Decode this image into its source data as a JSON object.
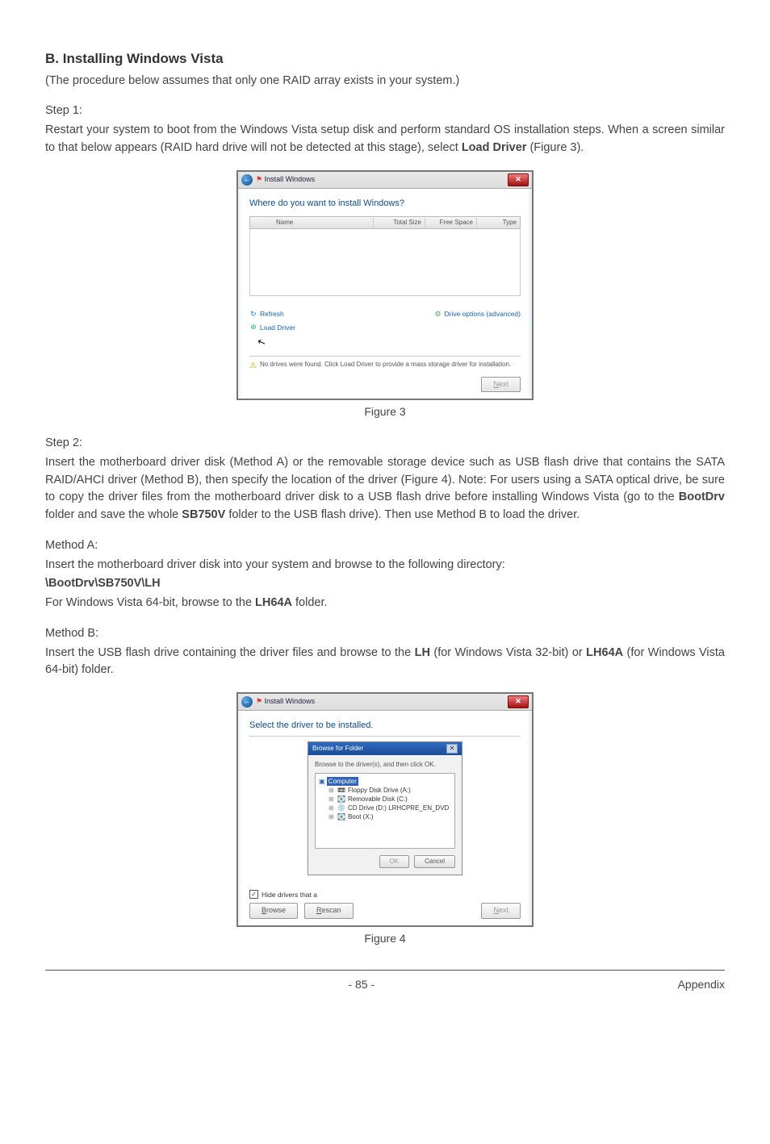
{
  "heading": "B. Installing Windows Vista",
  "subtitle": "(The procedure below assumes that only one RAID array exists in your system.)",
  "step1": {
    "label": "Step 1:",
    "text_parts": [
      "Restart your system to boot from the Windows Vista setup disk and perform standard OS installation steps. When a screen similar to that below appears (RAID hard drive will not be detected at this stage), select ",
      "Load Driver",
      " (Figure 3)."
    ]
  },
  "figure3": {
    "caption": "Figure 3",
    "dialog": {
      "titlebar_text": "Install Windows",
      "heading": "Where do you want to install Windows?",
      "columns": {
        "name": "Name",
        "total": "Total Size",
        "free": "Free Space",
        "type": "Type"
      },
      "refresh": "Refresh",
      "drive_options": "Drive options (advanced)",
      "load_driver": "Load Driver",
      "warning": "No drives were found. Click Load Driver to provide a mass storage driver for installation.",
      "next_btn": "Next"
    }
  },
  "step2": {
    "label": "Step 2:",
    "para_parts": [
      "Insert the motherboard driver disk (Method A) or the removable storage device such as USB flash drive that contains the SATA RAID/AHCI driver (Method B), then specify the location of the driver (Figure 4). Note: For users using a SATA optical drive, be sure to copy the driver files from the motherboard driver disk to a USB flash drive before installing Windows Vista (go to the ",
      "BootDrv",
      " folder and save the whole ",
      "SB750V",
      " folder to the USB flash drive). Then use Method B to load the driver."
    ]
  },
  "methodA": {
    "label": "Method A:",
    "line1": "Insert the motherboard driver disk into your system and browse to the following directory:",
    "path": "\\BootDrv\\SB750V\\LH",
    "line2_parts": [
      "For Windows Vista 64-bit, browse to the ",
      "LH64A",
      " folder."
    ]
  },
  "methodB": {
    "label": "Method B:",
    "para_parts": [
      "Insert the USB flash drive containing the driver files and browse to the ",
      "LH",
      " (for Windows Vista 32-bit) or ",
      "LH64A",
      " (for Windows Vista 64-bit) folder."
    ]
  },
  "figure4": {
    "caption": "Figure 4",
    "dialog": {
      "titlebar_text": "Install Windows",
      "heading": "Select the driver to be installed.",
      "browse": {
        "title": "Browse for Folder",
        "instruction": "Browse to the driver(s), and then click OK.",
        "root": "Computer",
        "items": [
          "Floppy Disk Drive (A:)",
          "Removable Disk (C:)",
          "CD Drive (D:) LRHCPRE_EN_DVD",
          "Boot (X:)"
        ],
        "ok": "OK",
        "cancel": "Cancel"
      },
      "hide_drivers": "Hide drivers that a",
      "browse_btn": "Browse",
      "rescan_btn": "Rescan",
      "next_btn": "Next"
    }
  },
  "footer": {
    "page": "- 85 -",
    "section": "Appendix"
  }
}
